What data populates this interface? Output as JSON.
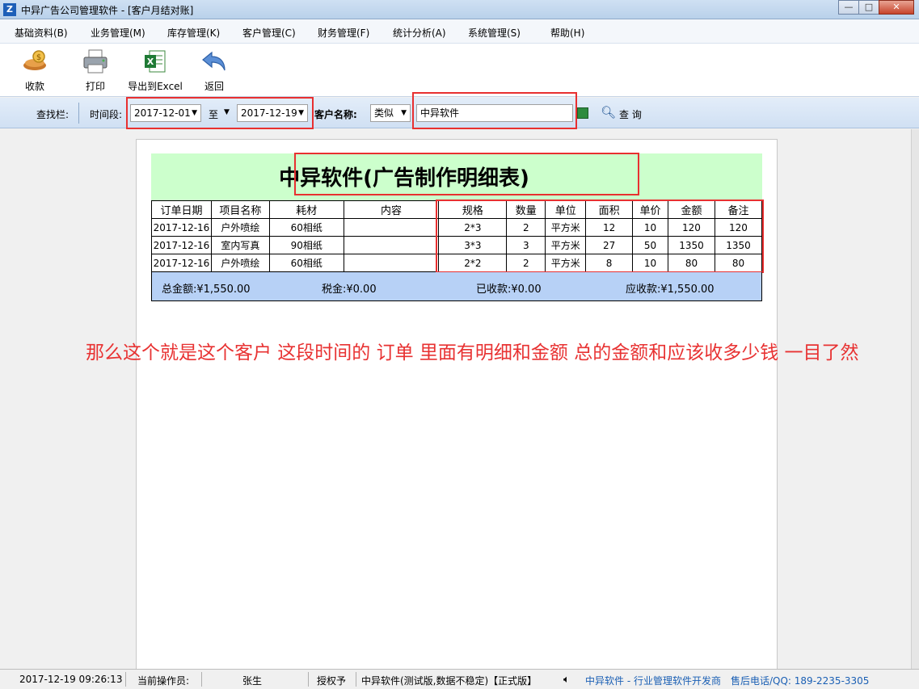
{
  "window": {
    "title": "中异广告公司管理软件 - [客户月结对账]",
    "app_icon": "Z",
    "minimize": "—",
    "maximize": "□",
    "close": "✕"
  },
  "menu": [
    "基础资料(B)",
    "业务管理(M)",
    "库存管理(K)",
    "客户管理(C)",
    "财务管理(F)",
    "统计分析(A)",
    "系统管理(S)",
    "帮助(H)"
  ],
  "toolbar": {
    "receive": "收款",
    "print": "打印",
    "export": "导出到Excel",
    "back": "返回"
  },
  "search": {
    "bar_label": "查找栏:",
    "period_label": "时间段:",
    "date_from": "2017-12-01",
    "to_label": "至",
    "date_to": "2017-12-19",
    "customer_label": "客户名称:",
    "match_mode": "类似",
    "customer_value": "中异软件",
    "query_label": "查 询"
  },
  "report": {
    "title": "中异软件(广告制作明细表)",
    "columns": [
      "订单日期",
      "项目名称",
      "耗材",
      "内容",
      "规格",
      "数量",
      "单位",
      "面积",
      "单价",
      "金额",
      "备注"
    ],
    "rows": [
      [
        "2017-12-16",
        "户外喷绘",
        "60相纸",
        "",
        "2*3",
        "2",
        "平方米",
        "12",
        "10",
        "120",
        "120"
      ],
      [
        "2017-12-16",
        "室内写真",
        "90相纸",
        "",
        "3*3",
        "3",
        "平方米",
        "27",
        "50",
        "1350",
        "1350"
      ],
      [
        "2017-12-16",
        "户外喷绘",
        "60相纸",
        "",
        "2*2",
        "2",
        "平方米",
        "8",
        "10",
        "80",
        "80"
      ]
    ],
    "totals": {
      "total_amount": "总金额:¥1,550.00",
      "tax": "税金:¥0.00",
      "received": "已收款:¥0.00",
      "receivable": "应收款:¥1,550.00"
    }
  },
  "annotation": "那么这个就是这个客户 这段时间的 订单 里面有明细和金额 总的金额和应该收多少钱 一目了然",
  "status": {
    "datetime": "2017-12-19 09:26:13",
    "operator_label": "当前操作员:",
    "operator": "张生",
    "license_label": "授权予",
    "license": "中异软件(测试版,数据不稳定)【正式版】",
    "vendor": "中异软件 - 行业管理软件开发商",
    "support": "售后电话/QQ: 189-2235-3305"
  },
  "colors": {
    "highlight_border": "#e83030",
    "report_header_bg": "#ccffcc",
    "totals_bg": "#b7d1f6",
    "annotation_text": "#e83232"
  }
}
